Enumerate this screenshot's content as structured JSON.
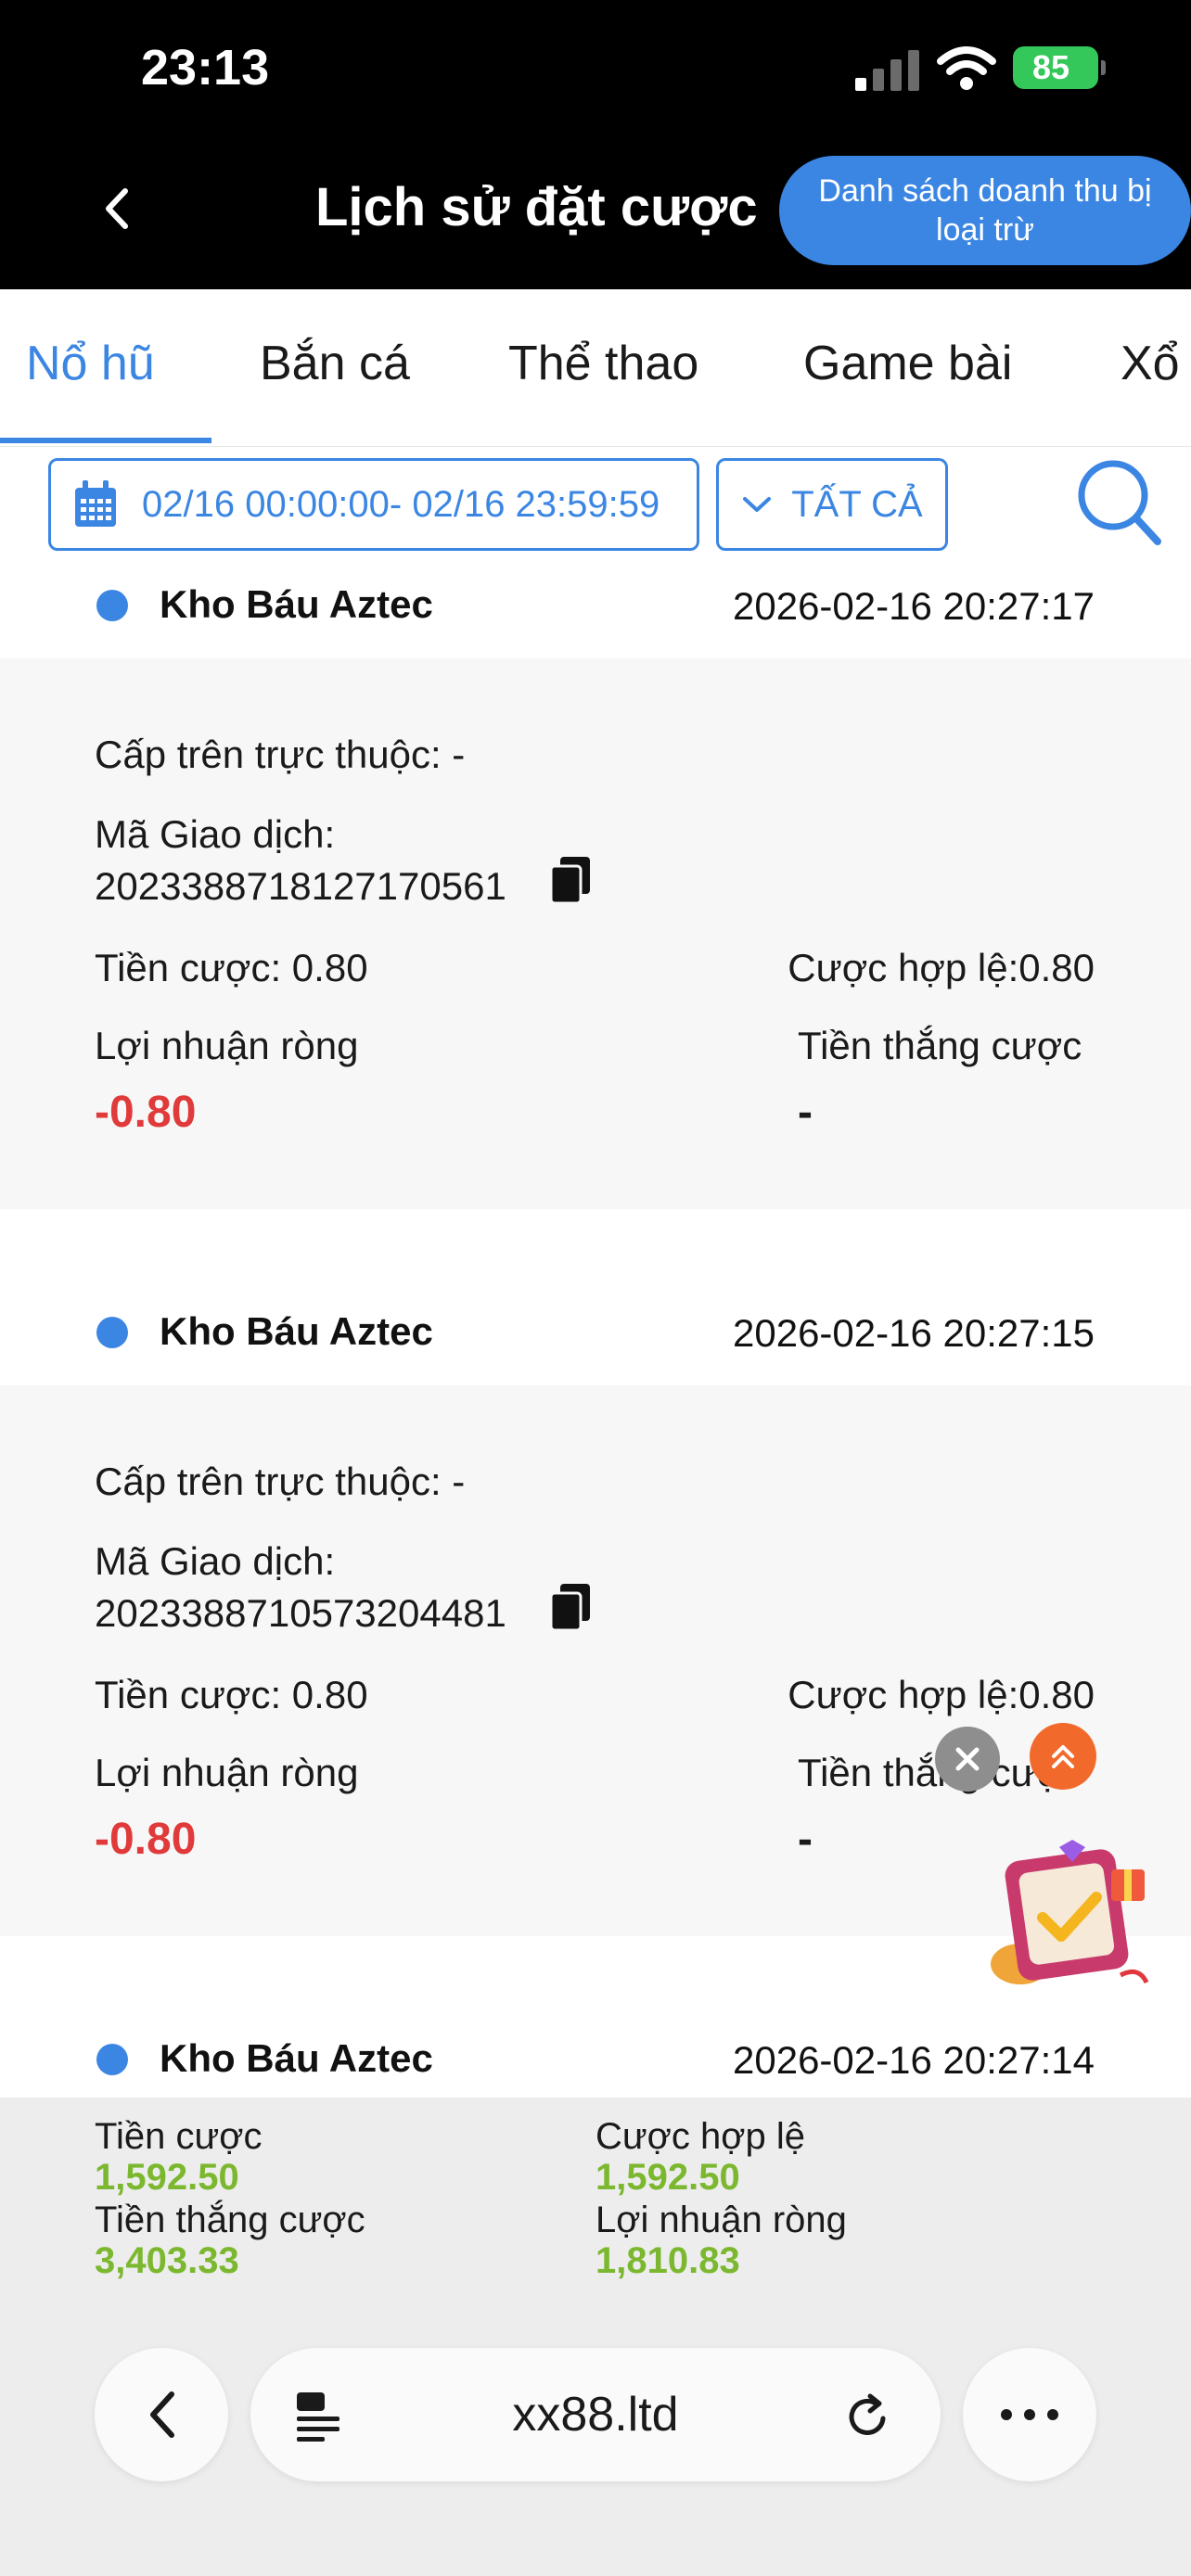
{
  "status": {
    "time": "23:13",
    "battery": "85"
  },
  "header": {
    "title": "Lịch sử đặt cược",
    "excluded_button": "Danh sách doanh thu bị loại trừ"
  },
  "tabs": [
    {
      "label": "Nổ hũ",
      "active": true
    },
    {
      "label": "Bắn cá",
      "active": false
    },
    {
      "label": "Thể thao",
      "active": false
    },
    {
      "label": "Game bài",
      "active": false
    },
    {
      "label": "Xổ",
      "active": false
    }
  ],
  "filters": {
    "date_range": "02/16 00:00:00- 02/16 23:59:59",
    "type": "TẤT CẢ"
  },
  "records": [
    {
      "game": "Kho Báu Aztec",
      "time": "2026-02-16 20:27:17",
      "upper_agent": "Cấp trên trực thuộc: -",
      "txn_label": "Mã Giao dịch:",
      "txn_id": "2023388718127170561",
      "bet": "Tiền cược: 0.80",
      "valid_bet": "Cược hợp lệ:0.80",
      "profit_label": "Lợi nhuận ròng",
      "profit": "-0.80",
      "win_label": "Tiền thắng cược",
      "win": "-"
    },
    {
      "game": "Kho Báu Aztec",
      "time": "2026-02-16 20:27:15",
      "upper_agent": "Cấp trên trực thuộc: -",
      "txn_label": "Mã Giao dịch:",
      "txn_id": "2023388710573204481",
      "bet": "Tiền cược: 0.80",
      "valid_bet": "Cược hợp lệ:0.80",
      "profit_label": "Lợi nhuận ròng",
      "profit": "-0.80",
      "win_label": "Tiền thắng cược",
      "win": "-"
    },
    {
      "game": "Kho Báu Aztec",
      "time": "2026-02-16 20:27:14"
    }
  ],
  "summary": {
    "bet_label": "Tiền cược",
    "bet": "1,592.50",
    "valid_label": "Cược hợp lệ",
    "valid": "1,592.50",
    "win_label": "Tiền thắng cược",
    "win": "3,403.33",
    "profit_label": "Lợi nhuận ròng",
    "profit": "1,810.83"
  },
  "browser": {
    "url": "xx88.ltd"
  },
  "colors": {
    "accent": "#3b86e3",
    "negative": "#e03a3a",
    "positive": "#7cb82f"
  }
}
